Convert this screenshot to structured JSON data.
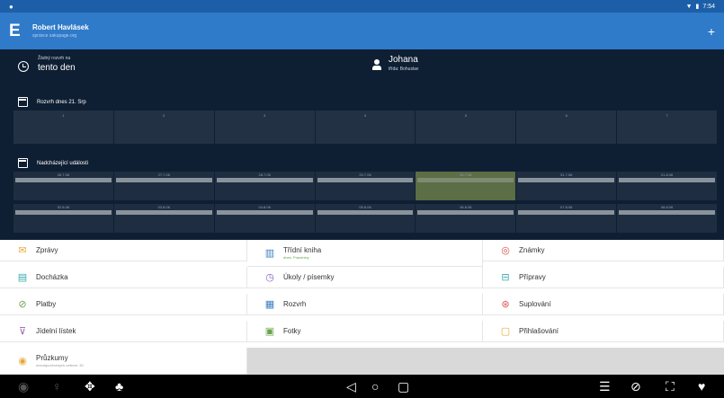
{
  "status_bar": {
    "left_icon": "notification-dot-icon",
    "time": "7:54"
  },
  "app_bar": {
    "logo": "E",
    "user_name": "Robert Havlásek",
    "user_sub": "správce zakupage.org",
    "plus_label": "+"
  },
  "info": {
    "schedule_small": "Žádný rozvrh na",
    "schedule_big": "tento den",
    "child_name": "Johana",
    "child_sub": "třída: Bohuslav"
  },
  "schedule": {
    "title": "Rozvrh dnes 21. Srp",
    "columns": [
      "1",
      "2",
      "3",
      "4",
      "5",
      "6",
      "7"
    ]
  },
  "events": {
    "title": "Nadcházející události",
    "row1": [
      {
        "date": "26.7.06"
      },
      {
        "date": "27.7.06"
      },
      {
        "date": "28.7.06"
      },
      {
        "date": "29.7.06"
      },
      {
        "date": "30.7.06",
        "highlight": true
      },
      {
        "date": "31.7.06"
      },
      {
        "date": "01.8.06"
      }
    ],
    "row2": [
      {
        "date": "02.8.06"
      },
      {
        "date": "03.8.06"
      },
      {
        "date": "04.8.06"
      },
      {
        "date": "05.8.06"
      },
      {
        "date": "06.8.06"
      },
      {
        "date": "07.8.06"
      },
      {
        "date": "08.8.06"
      }
    ]
  },
  "menu": {
    "zpravy": "Zprávy",
    "tridni_kniha": "Třídní kniha",
    "tridni_kniha_sub": "dnes: Prázdniny",
    "znamky": "Známky",
    "dochazka": "Docházka",
    "ukoly": "Úkoly / písemky",
    "pripravy": "Přípravy",
    "platby": "Platby",
    "rozvrh": "Rozvrh",
    "suplovani": "Suplování",
    "jidelni_listek": "Jídelní lístek",
    "fotky": "Fotky",
    "prihlasovani": "Přihlašování",
    "pruzkumy": "Průzkumy",
    "pruzkumy_sub": "nezodpovězených celkem: 30"
  },
  "colors": {
    "status_bar": "#1c5fa8",
    "app_bar": "#2f7ac9",
    "dashboard": "#0f1f33",
    "event_highlight": "#5b6e45"
  }
}
